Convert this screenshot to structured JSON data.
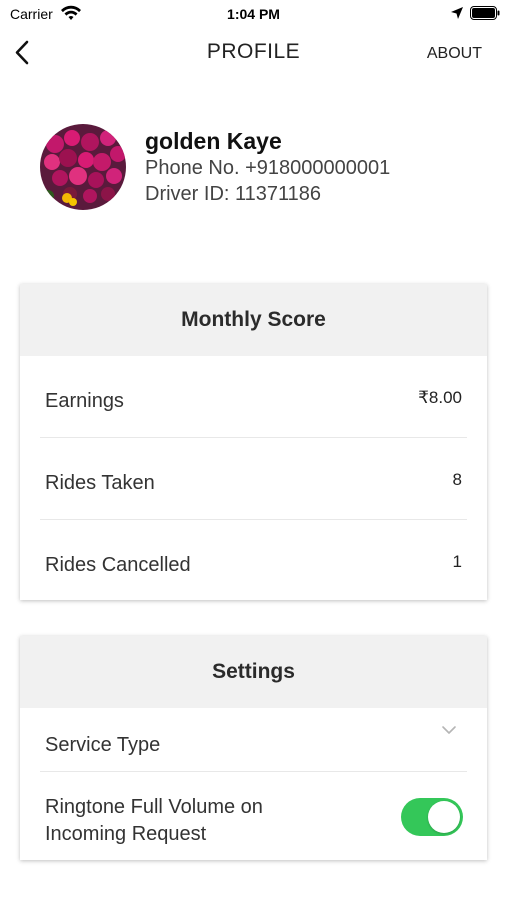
{
  "status_bar": {
    "carrier": "Carrier",
    "time": "1:04 PM"
  },
  "nav": {
    "title": "PROFILE",
    "about_label": "ABOUT",
    "back_icon": "back-chevron-icon"
  },
  "profile": {
    "name": "golden Kaye",
    "phone": "Phone No. +918000000001",
    "driver_id": "Driver ID: 11371186",
    "avatar_icon": "flower-avatar"
  },
  "monthly_score": {
    "title": "Monthly Score",
    "rows": [
      {
        "label": "Earnings",
        "value": "₹8.00"
      },
      {
        "label": "Rides Taken",
        "value": "8"
      },
      {
        "label": "Rides Cancelled",
        "value": "1"
      }
    ]
  },
  "settings": {
    "title": "Settings",
    "service_type_label": "Service Type",
    "ringtone_label": "Ringtone Full Volume on Incoming Request",
    "ringtone_enabled": true
  },
  "colors": {
    "toggle_on": "#34c759",
    "card_header_bg": "#f1f1f1"
  }
}
